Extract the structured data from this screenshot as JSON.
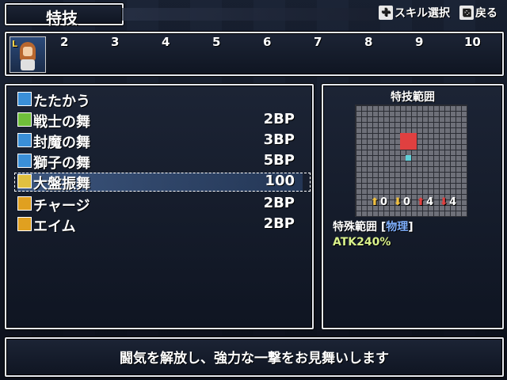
{
  "header": {
    "title": "特技"
  },
  "help": {
    "skill_select_icon": "dpad-icon",
    "skill_select_label": "スキル選択",
    "back_icon": "x-button-icon",
    "back_label": "戻る"
  },
  "party": {
    "level_badge": "L",
    "slots": [
      "2",
      "3",
      "4",
      "5",
      "6",
      "7",
      "8",
      "9",
      "10"
    ]
  },
  "skills": [
    {
      "name": "たたかう",
      "cost": "",
      "icon_color": "#3a8fd8"
    },
    {
      "name": "戦士の舞",
      "cost": "2BP",
      "icon_color": "#6fbf3a"
    },
    {
      "name": "封魔の舞",
      "cost": "3BP",
      "icon_color": "#3a8fd8"
    },
    {
      "name": "獅子の舞",
      "cost": "5BP",
      "icon_color": "#3a8fd8"
    },
    {
      "name": "大盤振舞",
      "cost": "100",
      "icon_color": "#e0c040"
    },
    {
      "name": "チャージ",
      "cost": "2BP",
      "icon_color": "#e0a020"
    },
    {
      "name": "エイム",
      "cost": "2BP",
      "icon_color": "#e0a020"
    }
  ],
  "selected_index": 4,
  "range": {
    "title": "特技範囲",
    "effects": [
      "0",
      "0",
      "4",
      "4"
    ],
    "range_label": "特殊範囲",
    "type_label": "物理",
    "atk": "ATK240%"
  },
  "description": "闘気を解放し、強力な一撃をお見舞いします",
  "colors": {
    "highlight_red": "#e04040",
    "target_cyan": "#5fd0d8",
    "type_blue": "#7fb0ff"
  }
}
